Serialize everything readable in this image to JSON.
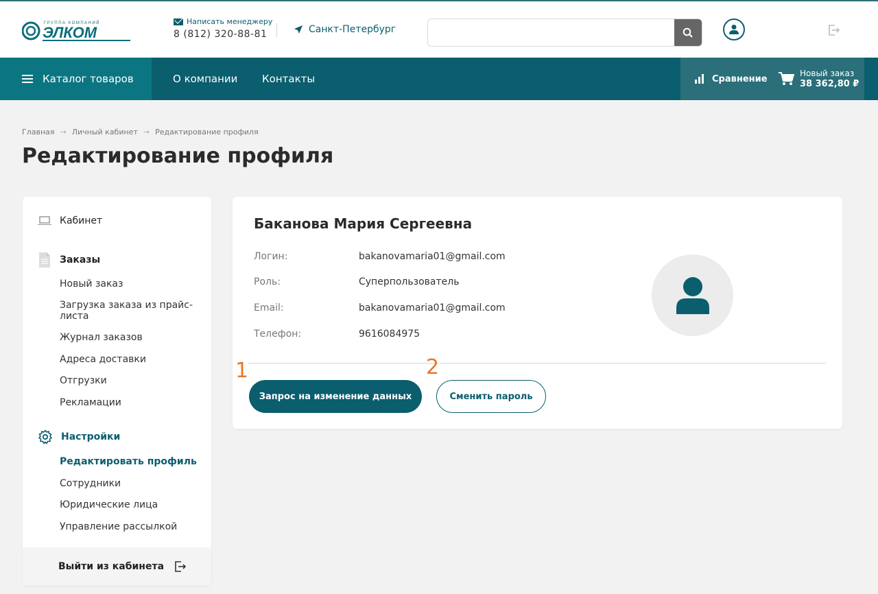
{
  "header": {
    "logo_caption": "ГРУППА КОМПАНИЙ",
    "logo_text": "ЭЛКОМ",
    "write_manager": "Написать менеджеру",
    "phone": "8 (812) 320-88-81",
    "city": "Санкт-Петербург",
    "search_placeholder": ""
  },
  "nav": {
    "catalog": "Каталог товаров",
    "about": "О компании",
    "contacts": "Контакты",
    "compare": "Сравнение",
    "cart_label": "Новый заказ",
    "cart_total": "38 362,80 ₽"
  },
  "breadcrumb": [
    "Главная",
    "Личный кабинет",
    "Редактирование профиля"
  ],
  "breadcrumb_separator": "→",
  "page_title": "Редактирование профиля",
  "sidebar": {
    "cabinet": "Кабинет",
    "orders_heading": "Заказы",
    "orders_items": [
      "Новый заказ",
      "Загрузка заказа из прайс-листа",
      "Журнал заказов",
      "Адреса доставки",
      "Отгрузки",
      "Рекламации"
    ],
    "settings_heading": "Настройки",
    "settings_items": [
      "Редактировать профиль",
      "Сотрудники",
      "Юридические лица",
      "Управление рассылкой"
    ],
    "logout": "Выйти из кабинета"
  },
  "profile": {
    "name": "Баканова Мария Сергеевна",
    "login_label": "Логин:",
    "login_value": "bakanovamaria01@gmail.com",
    "role_label": "Роль:",
    "role_value": "Суперпользователь",
    "email_label": "Email:",
    "email_value": "bakanovamaria01@gmail.com",
    "phone_label": "Телефон:",
    "phone_value": "9616084975",
    "request_button": "Запрос на изменение данных",
    "password_button": "Сменить пароль"
  },
  "annotations": [
    "1",
    "2"
  ],
  "colors": {
    "brand": "#0a5e6e",
    "catalog_bg": "#0b7682",
    "annotation": "#e8782a"
  }
}
